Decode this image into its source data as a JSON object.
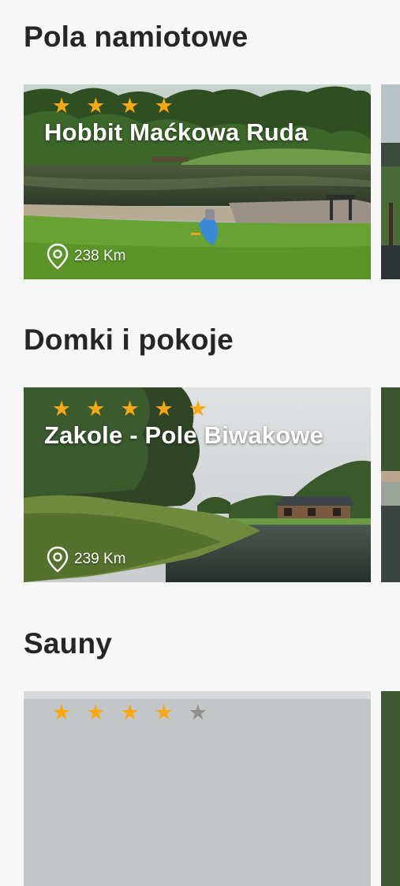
{
  "sections": [
    {
      "title": "Pola namiotowe",
      "card": {
        "name": "Hobbit Maćkowa Ruda",
        "rating": 4,
        "distance": "238 Km"
      }
    },
    {
      "title": "Domki i pokoje",
      "card": {
        "name": "Zakole - Pole Biwakowe",
        "rating": 5,
        "distance": "239 Km"
      }
    },
    {
      "title": "Sauny",
      "card": {
        "name": "",
        "rating": 4,
        "distance": ""
      }
    }
  ],
  "icons": {
    "star": "star-icon",
    "location": "location-pin-icon"
  },
  "colors": {
    "star_active": "#f7a814",
    "star_inactive": "#8f8f8f",
    "heading": "#262626"
  }
}
